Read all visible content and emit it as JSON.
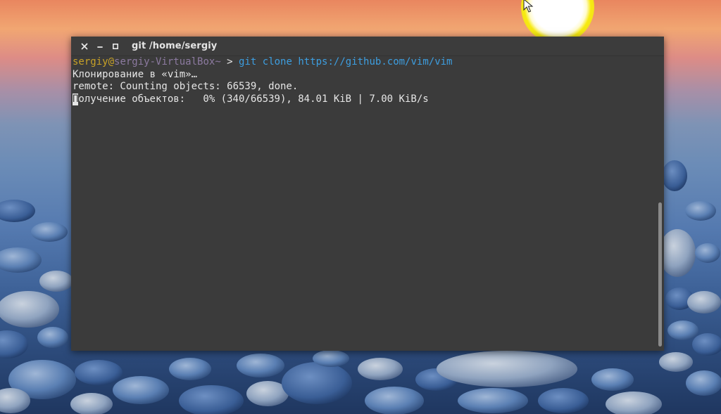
{
  "window": {
    "title": "git  /home/sergiy",
    "controls": {
      "close_icon": "close-icon",
      "minimize_icon": "minimize-icon",
      "maximize_icon": "maximize-icon"
    }
  },
  "terminal": {
    "prompt": {
      "user": "sergiy",
      "at": "@",
      "host": "sergiy-VirtualBox",
      "path": "~",
      "symbol": " > ",
      "command": "git clone https://github.com/vim/vim"
    },
    "output": [
      "Клонирование в «vim»…",
      "remote: Counting objects: 66539, done."
    ],
    "progress_line": {
      "first_char": "П",
      "rest": "олучение объектов:   0% (340/66539), 84.01 KiB | 7.00 KiB/s"
    }
  },
  "scrollbar": {
    "position_fraction": 0.55
  },
  "colors": {
    "terminal_bg": "#3b3b3b",
    "user": "#c9a227",
    "host": "#8c7aa0",
    "command": "#3d9ee0",
    "text": "#e6e6e6"
  }
}
